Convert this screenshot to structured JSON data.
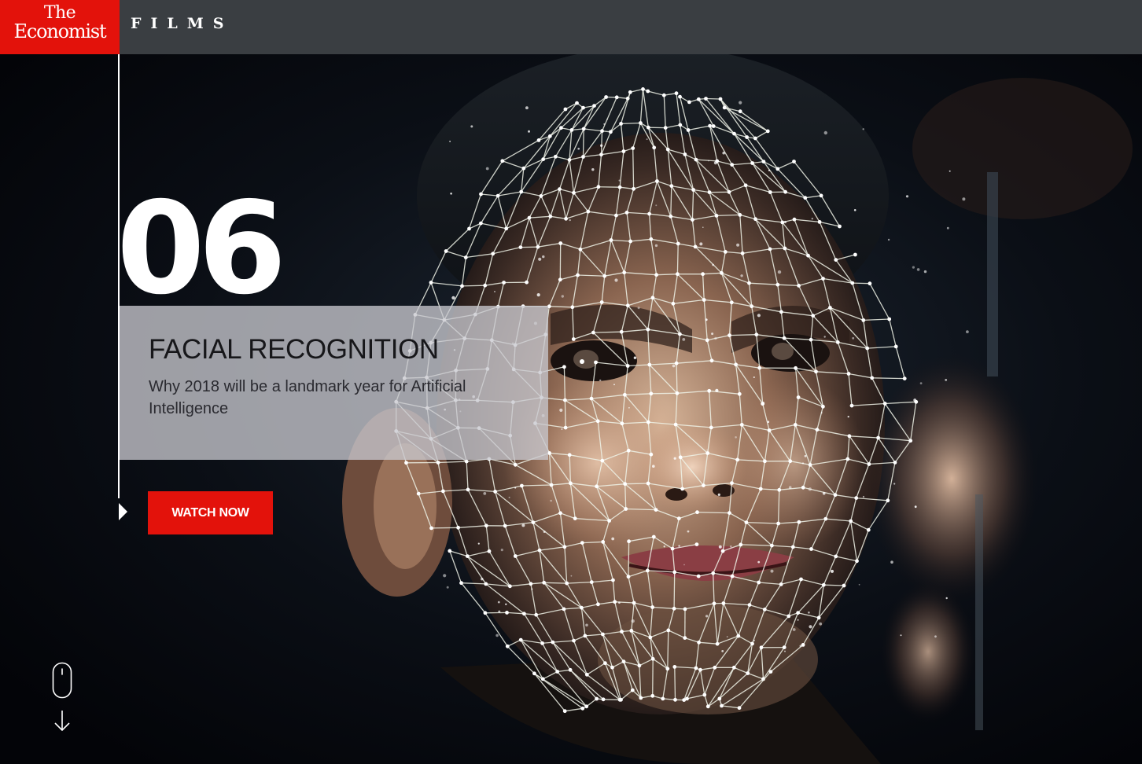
{
  "header": {
    "logo_line1": "The",
    "logo_line2": "Economist",
    "section": "FILMS",
    "brand_color": "#e3120b",
    "bar_color": "#3a3e42"
  },
  "story": {
    "number": "06",
    "title": "FACIAL RECOGNITION",
    "subtitle": "Why 2018 will be a landmark year for Artificial Intelligence",
    "cta_label": "WATCH NOW"
  },
  "icons": {
    "timeline_marker": "triangle-right-icon",
    "scroll": "mouse-icon",
    "scroll_arrow": "arrow-down-icon"
  }
}
